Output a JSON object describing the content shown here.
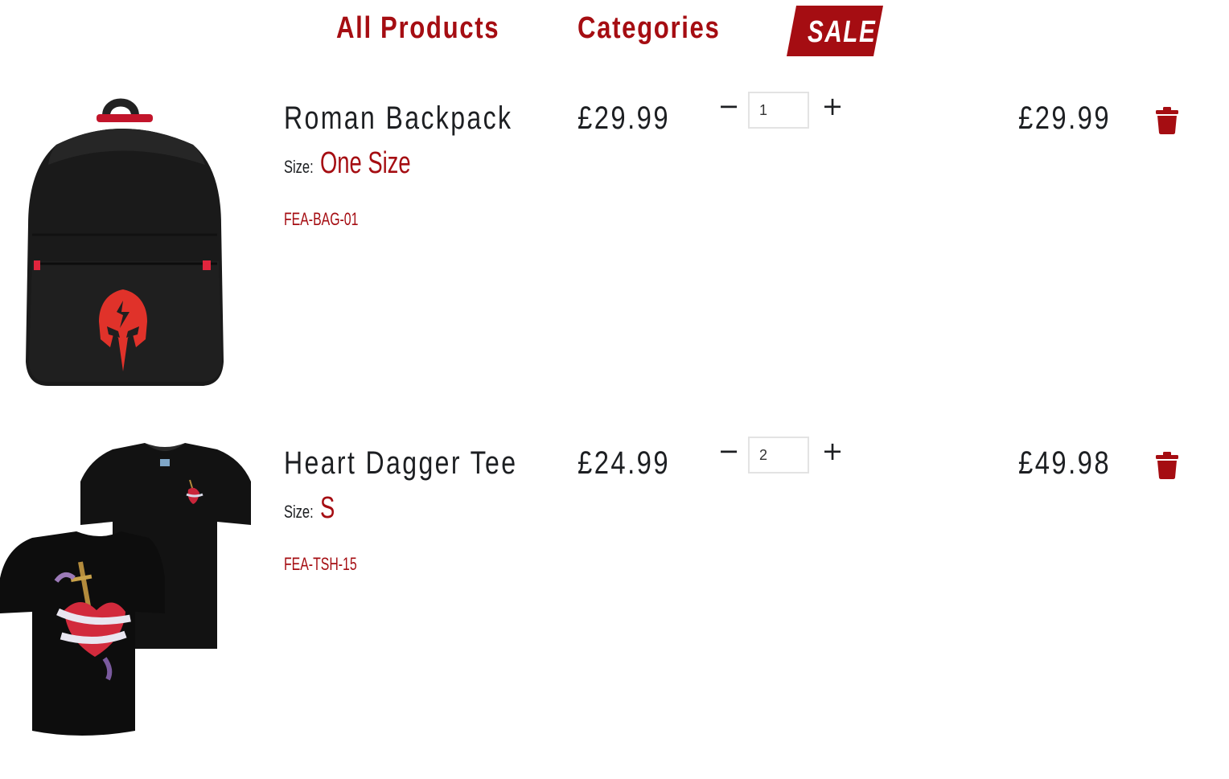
{
  "nav": {
    "all_products": "All Products",
    "categories": "Categories",
    "sale": "SALE"
  },
  "colors": {
    "accent": "#a50d12",
    "text": "#1d1f22",
    "logo_red": "#e0322a"
  },
  "cart": {
    "items": [
      {
        "title": "Roman Backpack",
        "size_label": "Size:",
        "size_value": "One Size",
        "sku": "FEA-BAG-01",
        "price": "£29.99",
        "quantity": "1",
        "line_total": "£29.99",
        "image_icon": "backpack-image"
      },
      {
        "title": "Heart Dagger Tee",
        "size_label": "Size:",
        "size_value": "S",
        "sku": "FEA-TSH-15",
        "price": "£24.99",
        "quantity": "2",
        "line_total": "£49.98",
        "image_icon": "tshirt-image"
      }
    ],
    "controls": {
      "minus": "−",
      "plus": "+",
      "delete_icon": "trash-icon"
    }
  }
}
